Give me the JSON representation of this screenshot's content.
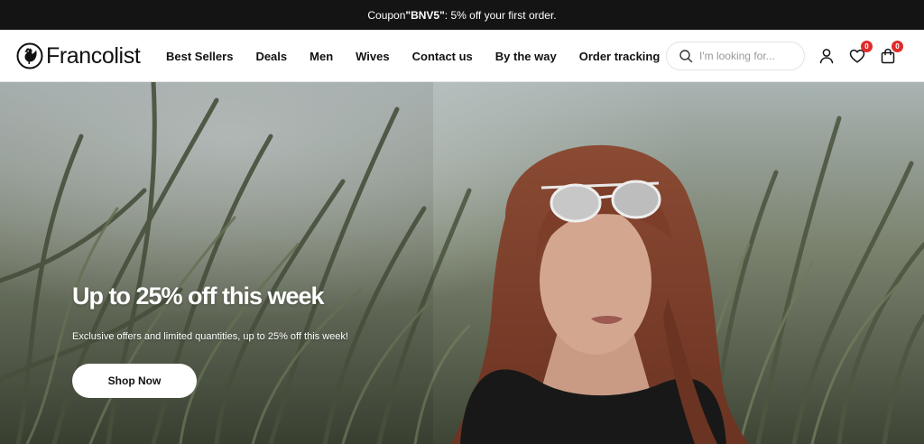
{
  "announcement": {
    "prefix": "Coupon ",
    "code": "\"BNV5\"",
    "suffix": ": 5% off your first order."
  },
  "header": {
    "logo_text": "Francolist",
    "logo_icon": "rooster-icon",
    "nav": [
      "Best Sellers",
      "Deals",
      "Men",
      "Wives",
      "Contact us",
      "By the way",
      "Order tracking"
    ],
    "search": {
      "placeholder": "I'm looking for...",
      "value": ""
    },
    "account_icon": "user-icon",
    "wishlist": {
      "icon": "heart-icon",
      "count": "0"
    },
    "cart": {
      "icon": "bag-icon",
      "count": "0"
    }
  },
  "hero": {
    "title": "Up to 25% off this week",
    "subtitle": "Exclusive offers and limited quantities, up to 25% off this week!",
    "cta_label": "Shop Now"
  },
  "colors": {
    "announcement_bg": "#141414",
    "badge": "#e02b2b",
    "text": "#111111",
    "button_bg": "#ffffff"
  }
}
